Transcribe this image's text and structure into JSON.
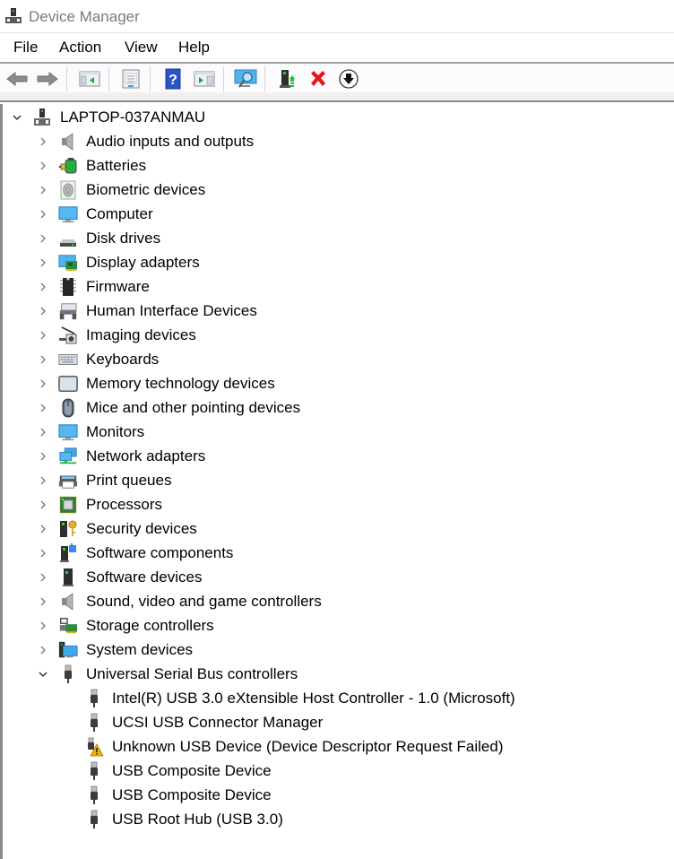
{
  "window": {
    "title": "Device Manager",
    "app_icon": "device-manager-icon"
  },
  "menubar": {
    "items": [
      {
        "label": "File"
      },
      {
        "label": "Action"
      },
      {
        "label": "View"
      },
      {
        "label": "Help"
      }
    ]
  },
  "toolbar": {
    "buttons": [
      {
        "name": "back",
        "icon": "arrow-left-icon",
        "enabled": false
      },
      {
        "name": "forward",
        "icon": "arrow-right-icon",
        "enabled": false
      },
      {
        "name": "show-hide-console-tree",
        "icon": "console-tree-icon"
      },
      {
        "name": "properties",
        "icon": "properties-icon"
      },
      {
        "name": "help",
        "icon": "help-icon"
      },
      {
        "name": "show-hide-action-pane",
        "icon": "action-pane-icon"
      },
      {
        "name": "scan-hardware-changes",
        "icon": "scan-monitor-icon"
      },
      {
        "name": "update-driver",
        "icon": "update-driver-icon"
      },
      {
        "name": "uninstall-device",
        "icon": "uninstall-x-icon"
      },
      {
        "name": "disable-device",
        "icon": "down-arrow-circle-icon"
      }
    ]
  },
  "tree": {
    "root": {
      "label": "LAPTOP-037ANMAU",
      "expanded": true,
      "icon": "computer-root-icon"
    },
    "categories": [
      {
        "label": "Audio inputs and outputs",
        "icon": "speaker-icon",
        "expanded": false
      },
      {
        "label": "Batteries",
        "icon": "battery-plug-icon",
        "expanded": false
      },
      {
        "label": "Biometric devices",
        "icon": "fingerprint-icon",
        "expanded": false
      },
      {
        "label": "Computer",
        "icon": "computer-monitor-icon",
        "expanded": false
      },
      {
        "label": "Disk drives",
        "icon": "disk-drive-icon",
        "expanded": false
      },
      {
        "label": "Display adapters",
        "icon": "display-adapter-icon",
        "expanded": false
      },
      {
        "label": "Firmware",
        "icon": "chip-icon",
        "expanded": false
      },
      {
        "label": "Human Interface Devices",
        "icon": "hid-icon",
        "expanded": false
      },
      {
        "label": "Imaging devices",
        "icon": "camera-icon",
        "expanded": false
      },
      {
        "label": "Keyboards",
        "icon": "keyboard-icon",
        "expanded": false
      },
      {
        "label": "Memory technology devices",
        "icon": "memory-card-icon",
        "expanded": false
      },
      {
        "label": "Mice and other pointing devices",
        "icon": "mouse-icon",
        "expanded": false
      },
      {
        "label": "Monitors",
        "icon": "monitor-icon",
        "expanded": false
      },
      {
        "label": "Network adapters",
        "icon": "network-icon",
        "expanded": false
      },
      {
        "label": "Print queues",
        "icon": "printer-icon",
        "expanded": false
      },
      {
        "label": "Processors",
        "icon": "processor-icon",
        "expanded": false
      },
      {
        "label": "Security devices",
        "icon": "security-key-icon",
        "expanded": false
      },
      {
        "label": "Software components",
        "icon": "software-component-icon",
        "expanded": false
      },
      {
        "label": "Software devices",
        "icon": "software-device-icon",
        "expanded": false
      },
      {
        "label": "Sound, video and game controllers",
        "icon": "speaker-icon",
        "expanded": false
      },
      {
        "label": "Storage controllers",
        "icon": "storage-controller-icon",
        "expanded": false
      },
      {
        "label": "System devices",
        "icon": "system-devices-icon",
        "expanded": false
      },
      {
        "label": "Universal Serial Bus controllers",
        "icon": "usb-plug-icon",
        "expanded": true,
        "children": [
          {
            "label": "Intel(R) USB 3.0 eXtensible Host Controller - 1.0 (Microsoft)",
            "icon": "usb-plug-icon",
            "warning": false
          },
          {
            "label": "UCSI USB Connector Manager",
            "icon": "usb-plug-icon",
            "warning": false
          },
          {
            "label": "Unknown USB Device (Device Descriptor Request Failed)",
            "icon": "usb-warning-icon",
            "warning": true
          },
          {
            "label": "USB Composite Device",
            "icon": "usb-plug-icon",
            "warning": false
          },
          {
            "label": "USB Composite Device",
            "icon": "usb-plug-icon",
            "warning": false
          },
          {
            "label": "USB Root Hub (USB 3.0)",
            "icon": "usb-plug-icon",
            "warning": false
          }
        ]
      }
    ]
  },
  "colors": {
    "title_text": "#7a7a7a",
    "toolbar_bg": "#fbfbfd",
    "warning": "#f2b400",
    "error_red": "#e8141b"
  }
}
